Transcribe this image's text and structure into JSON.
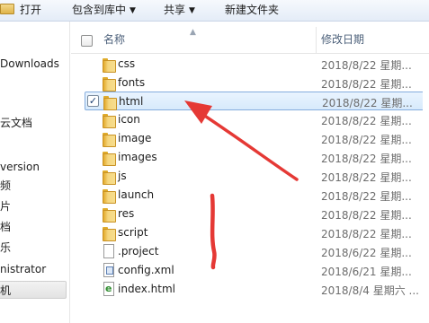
{
  "toolbar": {
    "open_label": "打开",
    "include_label": "包含到库中",
    "share_label": "共享",
    "new_folder_label": "新建文件夹"
  },
  "nav": {
    "items": [
      {
        "label": "Downloads"
      },
      {
        "label": "云文档"
      },
      {
        "label": "version"
      },
      {
        "label": "频"
      },
      {
        "label": "片"
      },
      {
        "label": "档"
      },
      {
        "label": "乐"
      },
      {
        "label": "nistrator"
      },
      {
        "label": "机"
      }
    ]
  },
  "columns": {
    "name": "名称",
    "date": "修改日期"
  },
  "files": [
    {
      "name": "css",
      "date": "2018/8/22 星期...",
      "type": "folder",
      "selected": false
    },
    {
      "name": "fonts",
      "date": "2018/8/22 星期...",
      "type": "folder",
      "selected": false
    },
    {
      "name": "html",
      "date": "2018/8/22 星期...",
      "type": "folder",
      "selected": true
    },
    {
      "name": "icon",
      "date": "2018/8/22 星期...",
      "type": "folder",
      "selected": false
    },
    {
      "name": "image",
      "date": "2018/8/22 星期...",
      "type": "folder",
      "selected": false
    },
    {
      "name": "images",
      "date": "2018/8/22 星期...",
      "type": "folder",
      "selected": false
    },
    {
      "name": "js",
      "date": "2018/8/22 星期...",
      "type": "folder",
      "selected": false
    },
    {
      "name": "launch",
      "date": "2018/8/22 星期...",
      "type": "folder",
      "selected": false
    },
    {
      "name": "res",
      "date": "2018/8/22 星期...",
      "type": "folder",
      "selected": false
    },
    {
      "name": "script",
      "date": "2018/8/22 星期...",
      "type": "folder",
      "selected": false
    },
    {
      "name": ".project",
      "date": "2018/6/22 星期...",
      "type": "file",
      "selected": false
    },
    {
      "name": "config.xml",
      "date": "2018/6/21 星期...",
      "type": "xml",
      "selected": false
    },
    {
      "name": "index.html",
      "date": "2018/8/4 星期六 ...",
      "type": "html",
      "selected": false
    }
  ],
  "colors": {
    "selection_fill": "#d7eafc",
    "selection_border": "#84acdd",
    "folder": "#f5d67e",
    "annotation": "#e53935"
  },
  "icons": {
    "folder": "folder-icon",
    "file": "file-icon",
    "xml": "xml-file-icon",
    "html": "html-file-icon",
    "check": "checkbox-icon"
  }
}
